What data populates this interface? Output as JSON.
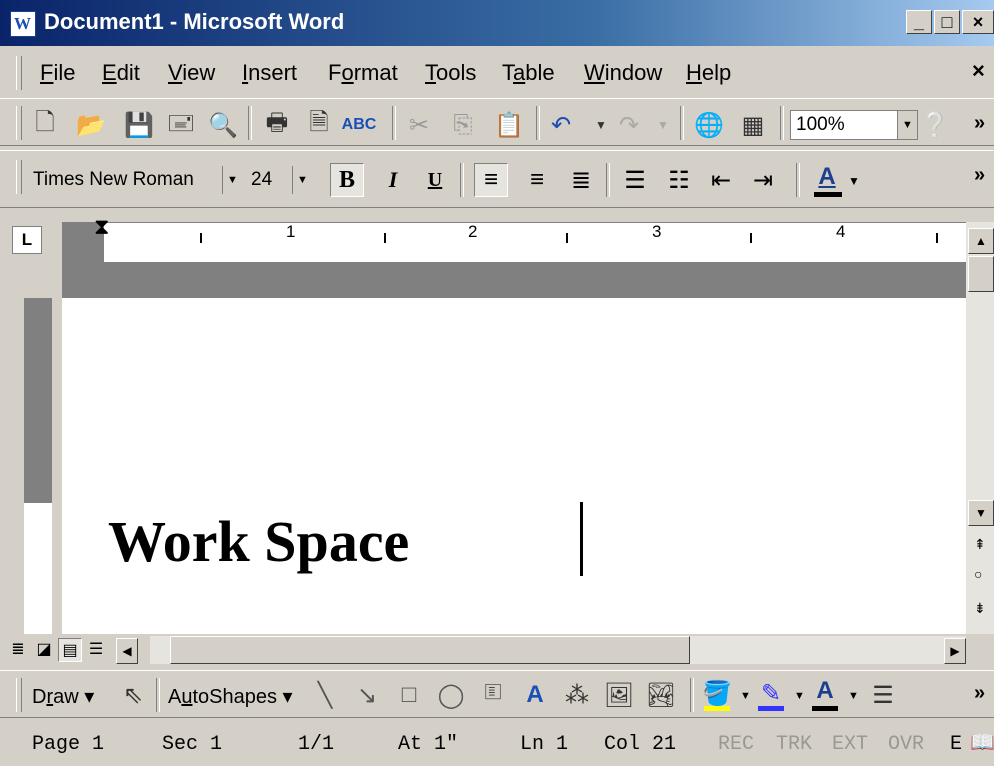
{
  "window": {
    "title": "Document1 - Microsoft Word",
    "icon_letter": "W"
  },
  "menu": {
    "items": [
      {
        "label": "File",
        "u": "F",
        "rest": "ile"
      },
      {
        "label": "Edit",
        "u": "E",
        "rest": "dit"
      },
      {
        "label": "View",
        "u": "V",
        "rest": "iew"
      },
      {
        "label": "Insert",
        "u": "I",
        "rest": "nsert"
      },
      {
        "label": "Format",
        "pre": "F",
        "u": "o",
        "rest": "rmat"
      },
      {
        "label": "Tools",
        "u": "T",
        "rest": "ools"
      },
      {
        "label": "Table",
        "pre": "T",
        "u": "a",
        "rest": "ble"
      },
      {
        "label": "Window",
        "u": "W",
        "rest": "indow"
      },
      {
        "label": "Help",
        "u": "H",
        "rest": "elp"
      }
    ],
    "close_glyph": "×"
  },
  "standard_toolbar": {
    "zoom": "100%",
    "more": "»"
  },
  "formatting_toolbar": {
    "font": "Times New Roman",
    "size": "24",
    "bold": "B",
    "italic": "I",
    "underline": "U",
    "font_color_letter": "A",
    "font_color": "#000000"
  },
  "ruler": {
    "tab_button": "L",
    "numbers": [
      "1",
      "2",
      "3",
      "4"
    ]
  },
  "document": {
    "text": "Work Space"
  },
  "drawing_toolbar": {
    "draw_label": "Draw",
    "draw_u": "r",
    "autoshapes_label": "AutoShapes",
    "fill_color": "#ffff00",
    "line_color": "#3333ff",
    "font_color": "#000000",
    "font_letter": "A"
  },
  "status": {
    "page": "Page 1",
    "sec": "Sec 1",
    "pages": "1/1",
    "at": "At 1\"",
    "ln": "Ln 1",
    "col": "Col 21",
    "rec": "REC",
    "trk": "TRK",
    "ext": "EXT",
    "ovr": "OVR",
    "lang": "E"
  }
}
